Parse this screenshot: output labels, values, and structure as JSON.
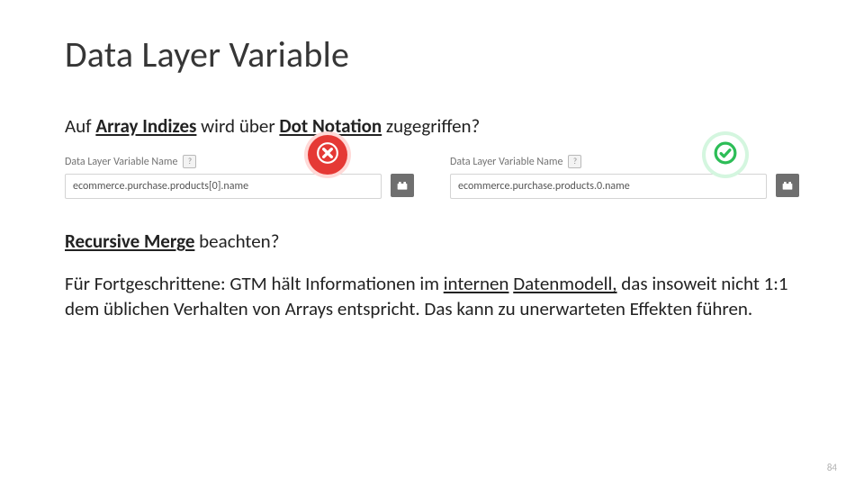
{
  "title": "Data Layer Variable",
  "lead": {
    "pre": "Auf ",
    "u1": "Array Indizes",
    "mid": " wird über ",
    "u2": "Dot Notation",
    "post": " zugegriffen?"
  },
  "field_label": "Data Layer Variable Name",
  "help_glyph": "?",
  "wrong_value": "ecommerce.purchase.products[0].name",
  "right_value": "ecommerce.purchase.products.0.name",
  "subhead": {
    "u": "Recursive Merge",
    "rest": " beachten?"
  },
  "para": {
    "p1": "Für Fortgeschrittene: GTM hält Informationen im ",
    "u1": "internen",
    "br": " ",
    "u2": "Datenmodell,",
    "p2": " das insoweit nicht 1:1 dem üblichen Verhalten von Arrays entspricht. Das kann zu unerwarteten Effekten führen."
  },
  "pagenum": "84"
}
